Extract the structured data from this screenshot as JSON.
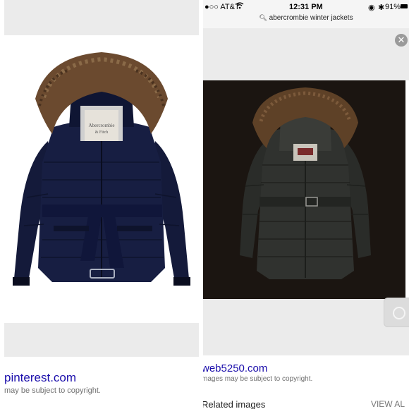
{
  "left": {
    "source": "pinterest.com",
    "copyright": "may be subject to copyright."
  },
  "right": {
    "status": {
      "carrier": "●○○ AT&T",
      "time": "12:31 PM",
      "battery": "91%"
    },
    "search_query": "abercrombie winter jackets",
    "source": "web5250.com",
    "copyright": "mages may be subject to copyright.",
    "related_label": "Related images",
    "view_all": "VIEW AL"
  },
  "colors": {
    "left_jacket": "#141a3a",
    "right_jacket": "#2a2c29",
    "fur": "#6b4a2f",
    "dark_bg": "#1b1511",
    "link": "#1a0dab"
  }
}
